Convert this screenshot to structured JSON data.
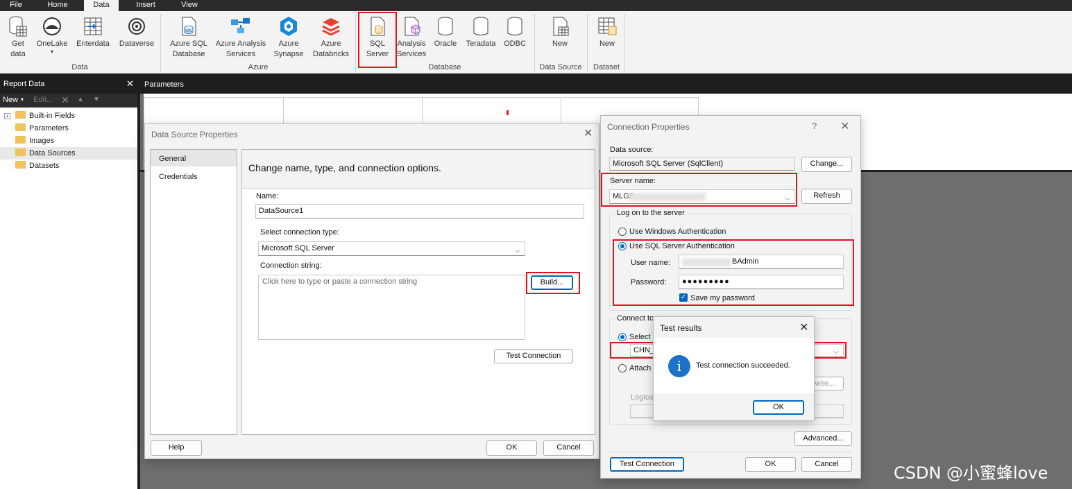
{
  "menu": {
    "file": "File",
    "home": "Home",
    "data": "Data",
    "insert": "Insert",
    "view": "View"
  },
  "ribbon": {
    "buttons": {
      "get_data": [
        "Get",
        "data"
      ],
      "onelake": [
        "OneLake",
        "▾"
      ],
      "enterdata": [
        "Enterdata"
      ],
      "dataverse": [
        "Dataverse"
      ],
      "azure_sql": [
        "Azure SQL",
        "Database"
      ],
      "azure_analysis": [
        "Azure Analysis",
        "Services"
      ],
      "azure_synapse": [
        "Azure",
        "Synapse"
      ],
      "azure_databricks": [
        "Azure",
        "Databricks"
      ],
      "sql_server": [
        "SQL",
        "Server"
      ],
      "analysis_services": [
        "Analysis",
        "Services"
      ],
      "oracle": [
        "Oracle"
      ],
      "teradata": [
        "Teradata"
      ],
      "odbc": [
        "ODBC"
      ],
      "new_datasource": [
        "New"
      ],
      "new_dataset": [
        "New"
      ]
    },
    "groups": {
      "data": "Data",
      "azure": "Azure",
      "database": "Database",
      "data_source": "Data Source",
      "dataset": "Dataset"
    }
  },
  "report_data": {
    "title": "Report Data",
    "close": "✕",
    "toolbar": {
      "new": "New",
      "edit": "Edit..."
    },
    "tree": [
      "Built-in Fields",
      "Parameters",
      "Images",
      "Data Sources",
      "Datasets"
    ]
  },
  "parameters_header": "Parameters",
  "ds_dialog": {
    "title": "Data Source Properties",
    "nav": [
      "General",
      "Credentials"
    ],
    "heading": "Change name, type, and connection options.",
    "name_label": "Name:",
    "name_value": "DataSource1",
    "type_label": "Select connection type:",
    "type_value": "Microsoft SQL Server",
    "conn_label": "Connection string:",
    "conn_placeholder": "Click here to type or paste a connection string",
    "build": "Build...",
    "test": "Test Connection",
    "help": "Help",
    "ok": "OK",
    "cancel": "Cancel"
  },
  "cp_dialog": {
    "title": "Connection Properties",
    "help": "?",
    "datasource_label": "Data source:",
    "datasource_value": "Microsoft SQL Server (SqlClient)",
    "change": "Change...",
    "server_label": "Server name:",
    "server_value": "MLGS",
    "refresh": "Refresh",
    "logon_legend": "Log on to the server",
    "win_auth": "Use Windows Authentication",
    "sql_auth": "Use SQL Server Authentication",
    "user_label": "User name:",
    "user_value": "BAdmin",
    "password_label": "Password:",
    "password_value": "●●●●●●●●●",
    "save_password": "Save my password",
    "connect_legend": "Connect to",
    "select_db": "Select",
    "db_value": "CHN_",
    "attach": "Attach",
    "browse": "owse...",
    "logical": "Logica",
    "advanced": "Advanced...",
    "test": "Test Connection",
    "ok": "OK",
    "cancel": "Cancel"
  },
  "test_dialog": {
    "title": "Test results",
    "message": "Test connection succeeded.",
    "ok": "OK"
  },
  "watermark": "CSDN @小蜜蜂love"
}
